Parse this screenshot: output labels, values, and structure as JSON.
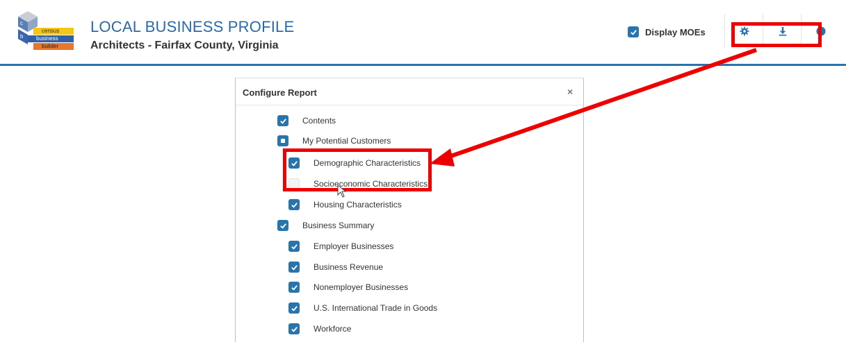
{
  "header": {
    "logo_lines": [
      "census",
      "business",
      "builder"
    ],
    "title": "LOCAL BUSINESS PROFILE",
    "subtitle": "Architects - Fairfax County, Virginia",
    "display_moes_label": "Display MOEs",
    "display_moes_checked": true,
    "tools": [
      {
        "icon": "gear-icon"
      },
      {
        "icon": "download-icon"
      },
      {
        "icon": "help-icon"
      }
    ]
  },
  "modal": {
    "title": "Configure Report",
    "close_symbol": "×",
    "items": [
      {
        "label": "Contents",
        "level": 1,
        "state": "checked"
      },
      {
        "label": "My Potential Customers",
        "level": 1,
        "state": "partial"
      },
      {
        "label": "Demographic Characteristics",
        "level": 2,
        "state": "checked"
      },
      {
        "label": "Socioeconomic Characteristics",
        "level": 2,
        "state": "unchecked"
      },
      {
        "label": "Housing Characteristics",
        "level": 2,
        "state": "checked"
      },
      {
        "label": "Business Summary",
        "level": 1,
        "state": "checked"
      },
      {
        "label": "Employer Businesses",
        "level": 2,
        "state": "checked"
      },
      {
        "label": "Business Revenue",
        "level": 2,
        "state": "checked"
      },
      {
        "label": "Nonemployer Businesses",
        "level": 2,
        "state": "checked"
      },
      {
        "label": "U.S. International Trade in Goods",
        "level": 2,
        "state": "checked"
      },
      {
        "label": "Workforce",
        "level": 2,
        "state": "checked"
      }
    ]
  },
  "colors": {
    "accent": "#2a74ad",
    "title_blue": "#2a6aa8",
    "annotation_red": "#ee0000"
  }
}
